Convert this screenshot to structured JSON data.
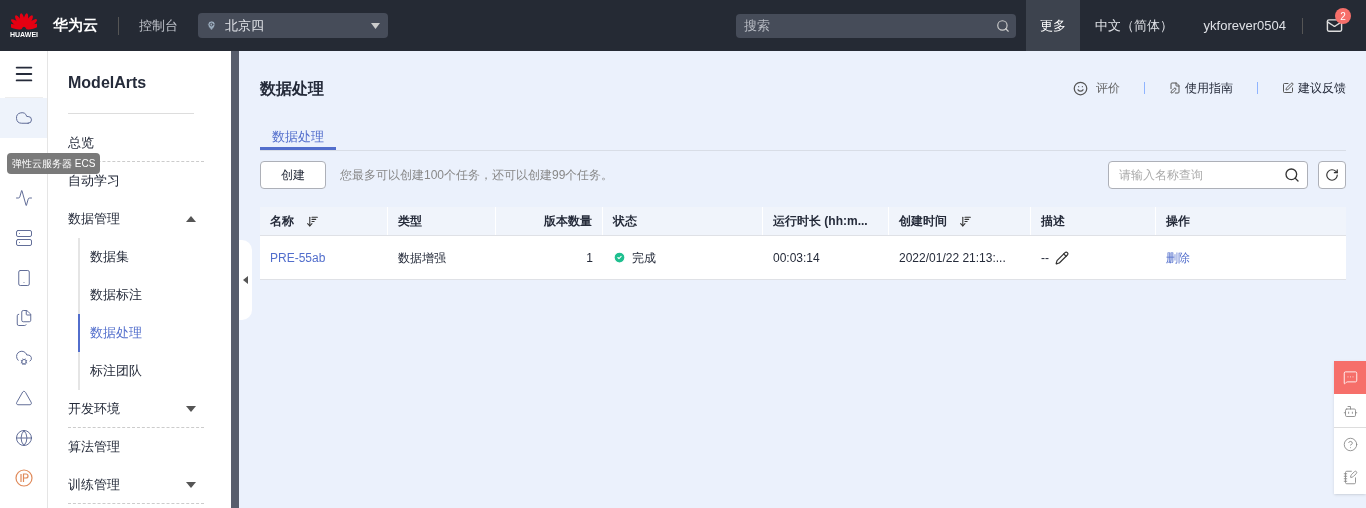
{
  "topbar": {
    "brand": "华为云",
    "logo_text": "HUAWEI",
    "console": "控制台",
    "region": "北京四",
    "search": {
      "placeholder": "搜索"
    },
    "more": "更多",
    "language": "中文（简体）",
    "user": "ykforever0504",
    "mail_badge": "2"
  },
  "rail": {
    "items": [
      {
        "selected": true
      },
      {
        "selected": false
      },
      {
        "selected": false
      },
      {
        "selected": false
      },
      {
        "selected": false
      },
      {
        "selected": false
      },
      {
        "selected": false
      },
      {
        "selected": false
      },
      {
        "selected": false
      }
    ],
    "tooltip": "弹性云服务器 ECS"
  },
  "sidebar": {
    "title": "ModelArts",
    "items": [
      {
        "label": "总览",
        "separated": true
      },
      {
        "label": "自动学习",
        "separated": false
      },
      {
        "label": "数据管理",
        "separated": false,
        "expanded": true,
        "children": [
          {
            "label": "数据集",
            "selected": false
          },
          {
            "label": "数据标注",
            "selected": false
          },
          {
            "label": "数据处理",
            "selected": true
          },
          {
            "label": "标注团队",
            "selected": false
          }
        ]
      },
      {
        "label": "开发环境",
        "separated": true,
        "expanded": false
      },
      {
        "label": "算法管理",
        "separated": false
      },
      {
        "label": "训练管理",
        "separated": true,
        "expanded": false
      }
    ]
  },
  "page": {
    "title": "数据处理",
    "links": [
      {
        "kind": "rate",
        "label": "评价"
      },
      {
        "kind": "guide",
        "label": "使用指南"
      },
      {
        "kind": "feedback",
        "label": "建议反馈"
      }
    ],
    "tabs": [
      {
        "label": "数据处理",
        "selected": true
      }
    ],
    "create_button": "创建",
    "quota_note": "您最多可以创建100个任务，还可以创建99个任务。",
    "search": {
      "placeholder": "请输入名称查询"
    }
  },
  "table": {
    "columns": [
      {
        "label": "名称",
        "sortable": true
      },
      {
        "label": "类型",
        "sortable": false
      },
      {
        "label": "版本数量",
        "sortable": false
      },
      {
        "label": "状态",
        "sortable": false
      },
      {
        "label": "运行时长 (hh:m...",
        "sortable": false
      },
      {
        "label": "创建时间",
        "sortable": true
      },
      {
        "label": "描述",
        "sortable": false
      },
      {
        "label": "操作",
        "sortable": false
      }
    ],
    "rows": [
      {
        "name": "PRE-55ab",
        "type": "数据增强",
        "versions": "1",
        "status": "完成",
        "duration": "00:03:14",
        "created": "2022/01/22 21:13:...",
        "description": "--",
        "action": "删除"
      }
    ]
  },
  "float_tools": [
    {
      "kind": "chat",
      "selected": true
    },
    {
      "kind": "bot",
      "selected": false
    },
    {
      "kind": "help",
      "selected": false
    },
    {
      "kind": "note",
      "selected": false
    }
  ]
}
